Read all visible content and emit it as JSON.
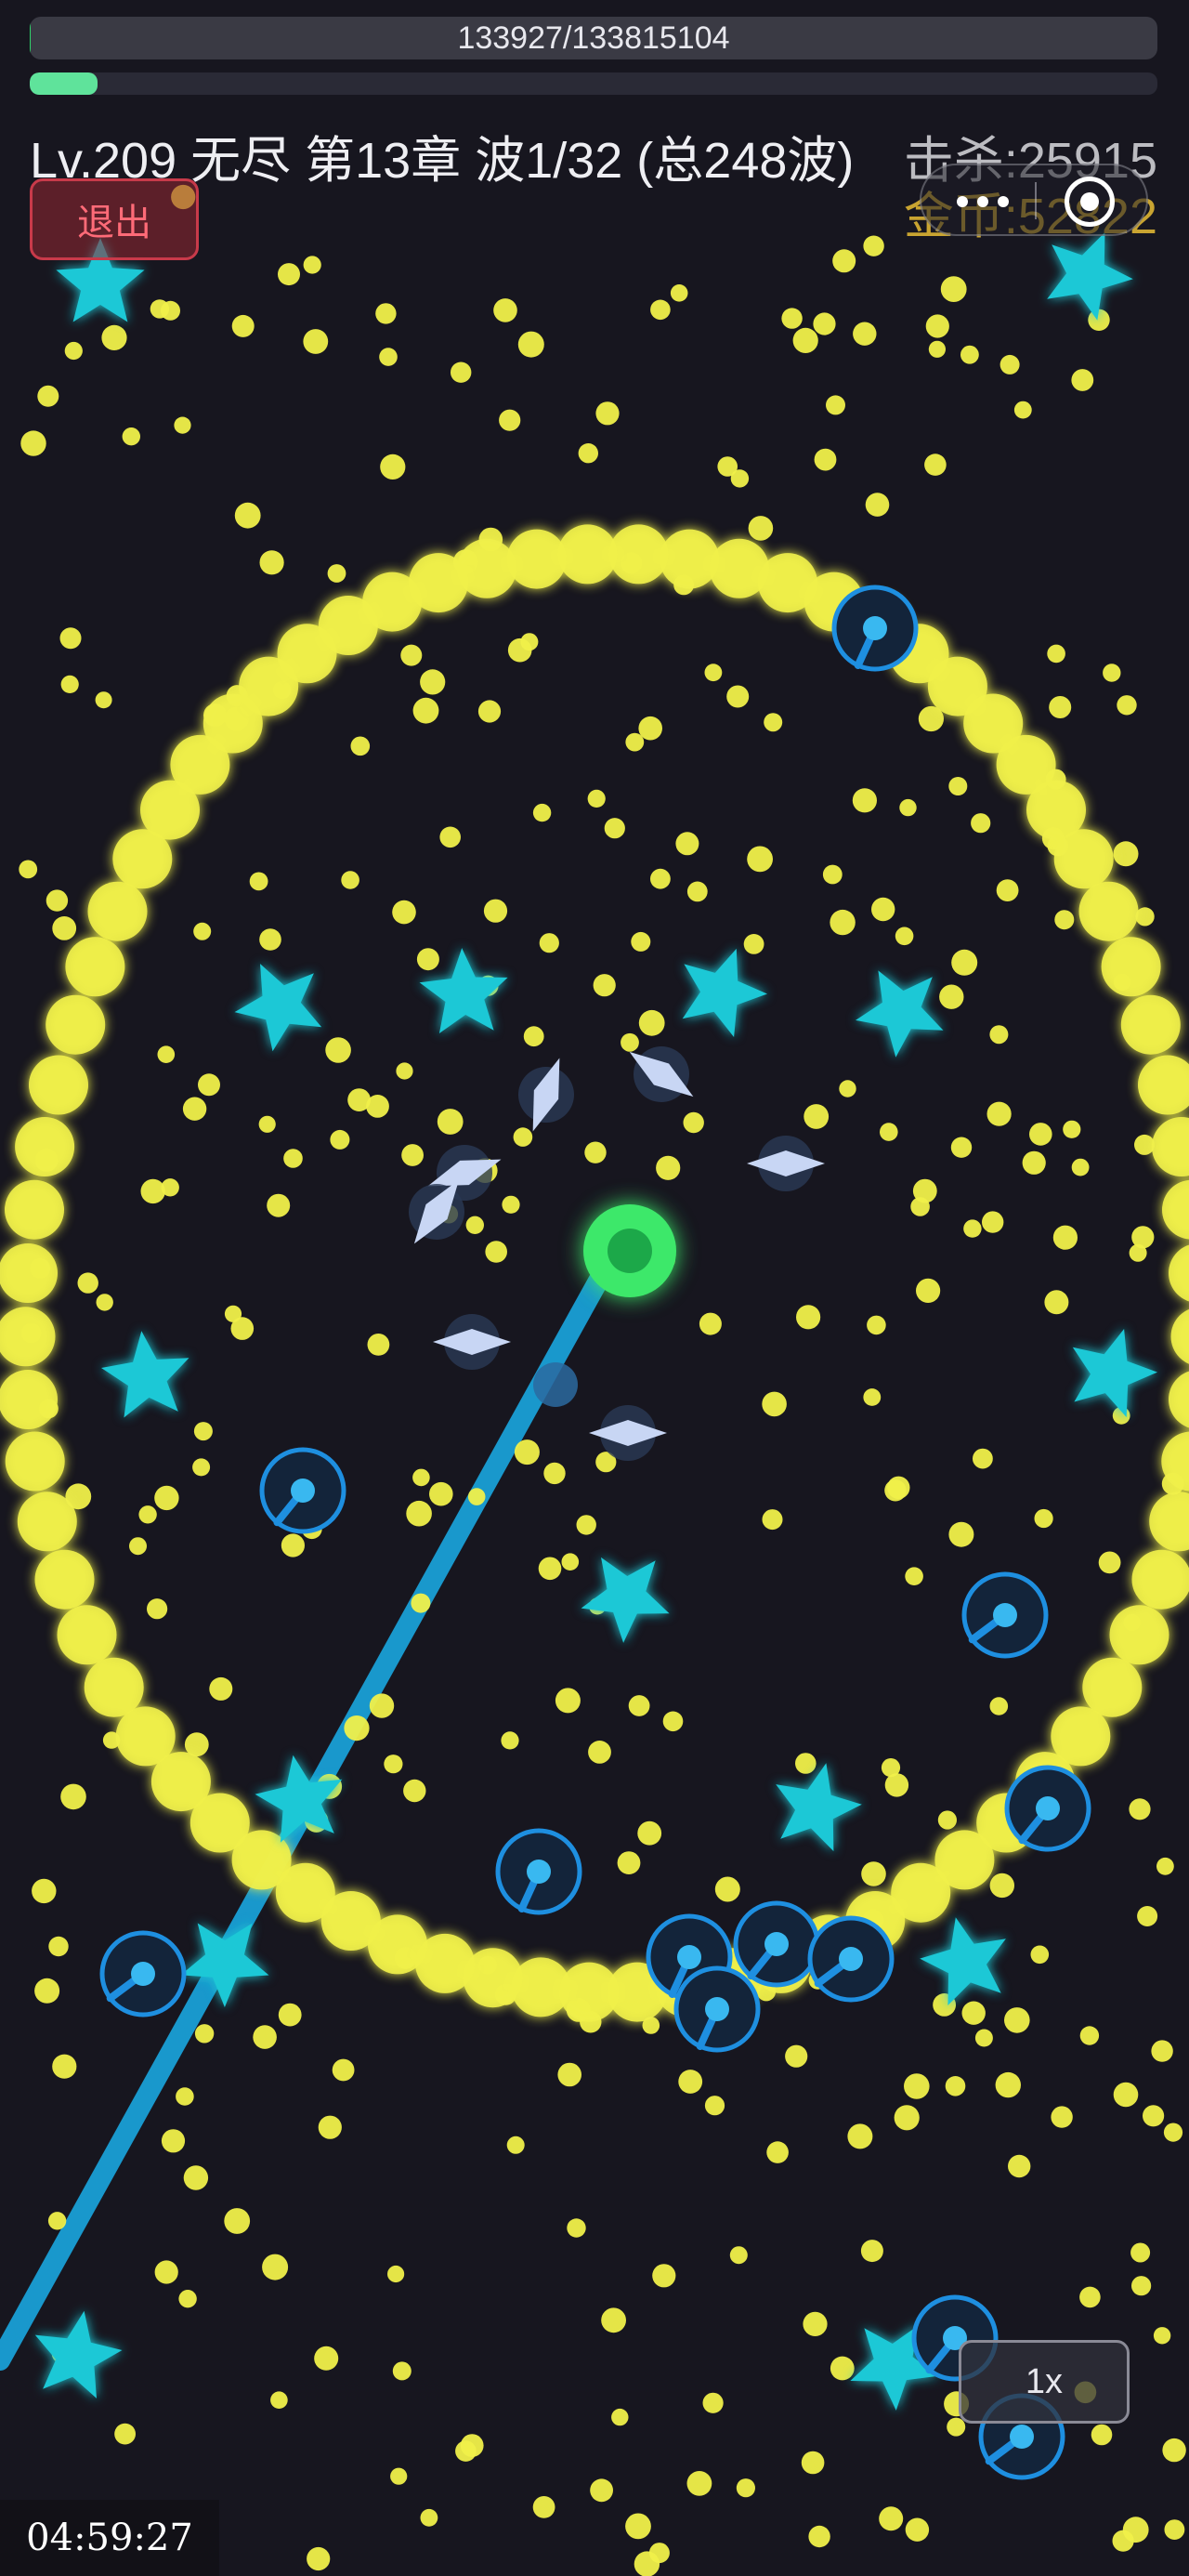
{
  "hud": {
    "hp_text": "133927/133815104",
    "hp_fraction": 0.001,
    "xp_fraction": 0.06,
    "level_text": "Lv.209  无尽 第13章 波1/32 (总248波)",
    "kills_text": "击杀:25915",
    "gold_text": "金币:52822",
    "exit_label": "退出",
    "speed_label": "1x",
    "timer_text": "04:59:27"
  },
  "icons": {
    "more": "more-dots-icon",
    "close": "capsule-close-icon"
  },
  "colors": {
    "background": "#17161f",
    "hp_fill": "#2fd36a",
    "xp_fill": "#5fe39b",
    "gold": "#c9a431",
    "exit": "#ff6b78",
    "enemy_ring": "#1e8fe0",
    "star": "#1ec8d6",
    "orb": "#f0f04a",
    "laser": "#1a9fd6",
    "player": "#3ee86a"
  }
}
